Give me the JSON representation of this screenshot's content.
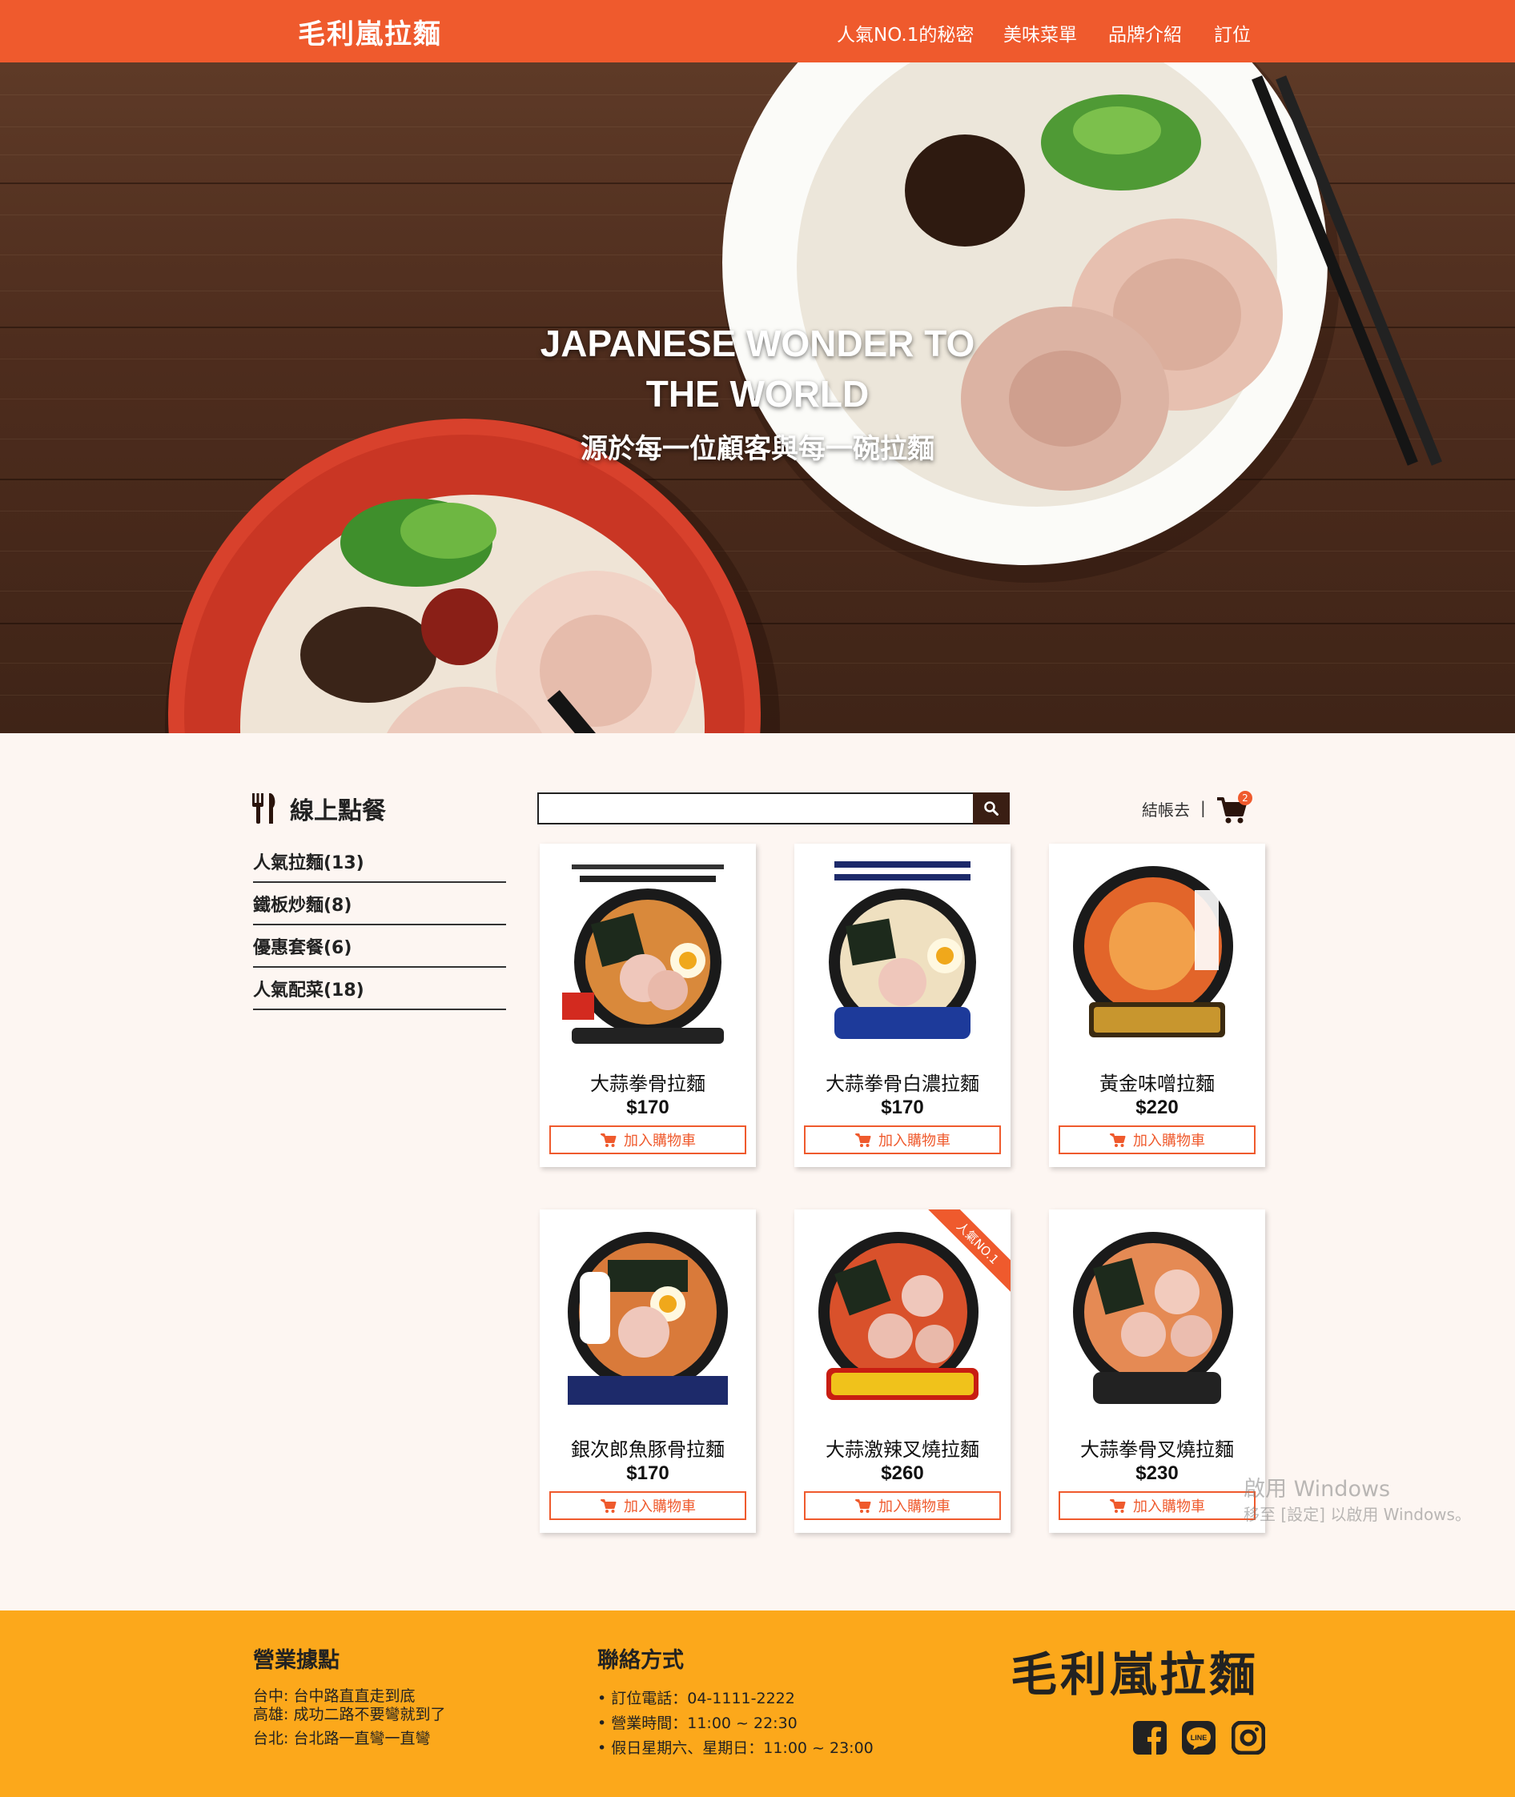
{
  "header": {
    "brand": "毛利嵐拉麵",
    "nav": [
      "人氣NO.1的秘密",
      "美味菜單",
      "品牌介紹",
      "訂位"
    ]
  },
  "hero": {
    "title_line1": "JAPANESE WONDER TO",
    "title_line2": "THE WORLD",
    "subtitle": "源於每一位顧客與每一碗拉麵"
  },
  "order": {
    "section_title": "線上點餐",
    "icon": "utensils-icon",
    "categories": [
      "人氣拉麵(13)",
      "鐵板炒麵(8)",
      "優惠套餐(6)",
      "人氣配菜(18)"
    ],
    "search": {
      "value": "",
      "placeholder": ""
    },
    "checkout_label": "結帳去",
    "separator": "|",
    "cart_count": "2",
    "add_label": "加入購物車",
    "products": [
      {
        "name": "大蒜拳骨拉麵",
        "price": "$170"
      },
      {
        "name": "大蒜拳骨白濃拉麵",
        "price": "$170"
      },
      {
        "name": "黃金味噌拉麵",
        "price": "$220"
      },
      {
        "name": "銀次郎魚豚骨拉麵",
        "price": "$170"
      },
      {
        "name": "大蒜激辣叉燒拉麵",
        "price": "$260",
        "ribbon": "人氣NO.1"
      },
      {
        "name": "大蒜拳骨叉燒拉麵",
        "price": "$230"
      }
    ]
  },
  "watermark": {
    "line1": "啟用 Windows",
    "line2": "移至 [設定] 以啟用 Windows。"
  },
  "footer": {
    "locations_title": "營業據點",
    "locations": [
      "台中: 台中路直直走到底",
      "高雄: 成功二路不要彎就到了",
      "台北: 台北路一直彎一直彎"
    ],
    "contact_title": "聯絡方式",
    "contact": [
      "• 訂位電話：04-1111-2222",
      "• 營業時間：11:00 ~ 22:30",
      "• 假日星期六、星期日：11:00 ~ 23:00"
    ],
    "brand": "毛利嵐拉麵",
    "social": [
      "facebook-icon",
      "line-icon",
      "instagram-icon"
    ]
  },
  "colors": {
    "primary": "#ef5a2d",
    "footer": "#fca81b",
    "background": "#fdf6f2",
    "dark": "#3a1e13"
  }
}
